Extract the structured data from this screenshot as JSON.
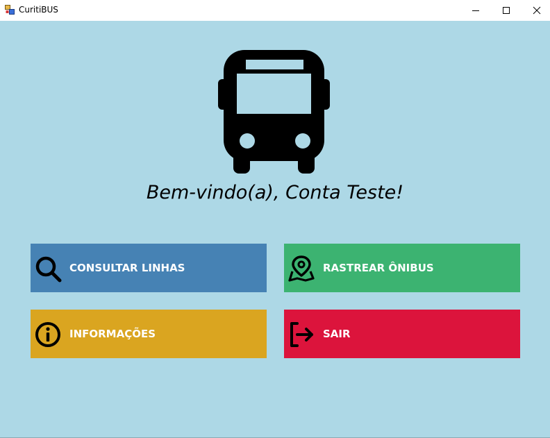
{
  "window": {
    "title": "CuritiBUS",
    "app_icon": "app-window-icon",
    "controls": [
      "minimize-icon",
      "maximize-icon",
      "close-icon"
    ]
  },
  "main": {
    "hero_icon": "bus-icon",
    "welcome_text": "Bem-vindo(a), Conta Teste!",
    "background_color": "#add8e6"
  },
  "buttons": [
    {
      "label": "CONSULTAR LINHAS",
      "icon": "search-icon",
      "color": "#4682b4"
    },
    {
      "label": "RASTREAR ÔNIBUS",
      "icon": "map-pin-icon",
      "color": "#3cb371"
    },
    {
      "label": "INFORMAÇÕES",
      "icon": "info-icon",
      "color": "#daa520"
    },
    {
      "label": "SAIR",
      "icon": "logout-icon",
      "color": "#dc143c"
    }
  ]
}
